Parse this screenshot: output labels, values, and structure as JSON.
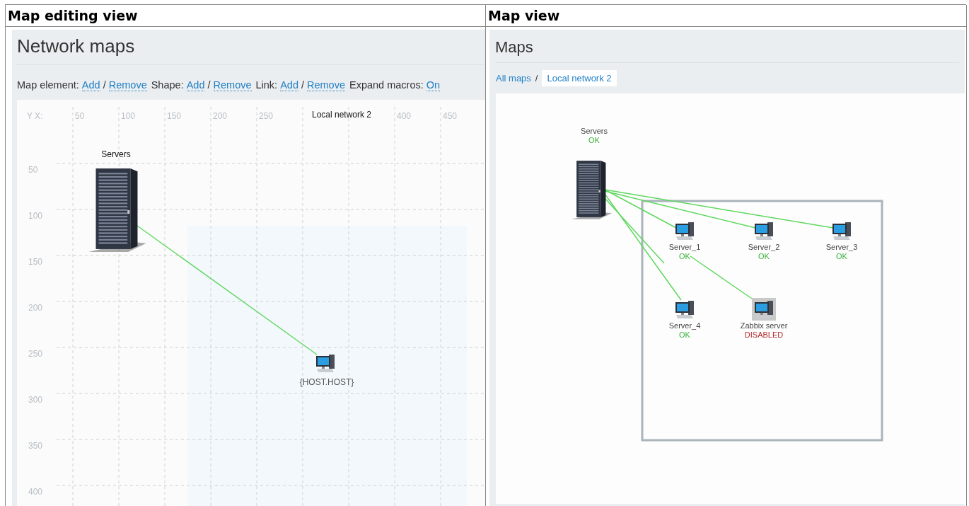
{
  "columns": [
    {
      "heading": "Map editing view"
    },
    {
      "heading": "Map view"
    }
  ],
  "map_editing": {
    "title": "Network maps",
    "toolbar": [
      {
        "label": "Map element:",
        "links": [
          "Add",
          "Remove"
        ],
        "separator": "/"
      },
      {
        "label": "Shape:",
        "links": [
          "Add",
          "Remove"
        ],
        "separator": "/"
      },
      {
        "label": "Link:",
        "links": [
          "Add",
          "Remove"
        ],
        "separator": "/"
      },
      {
        "label": "Expand macros:",
        "links": [
          "On"
        ]
      }
    ],
    "map": {
      "title": "Local network 2",
      "axis_label": "Y X:",
      "xticks": [
        "50",
        "100",
        "150",
        "200",
        "250",
        "400",
        "450"
      ],
      "yticks": [
        "50",
        "100",
        "150",
        "200",
        "250",
        "300",
        "350",
        "400"
      ],
      "elements": [
        {
          "label": "Servers"
        },
        {
          "label": "{HOST.HOST}"
        }
      ]
    }
  },
  "map_view": {
    "title": "Maps",
    "breadcrumbs": [
      {
        "label": "All maps",
        "selected": false
      },
      {
        "label": "Local network 2",
        "selected": true
      }
    ],
    "breadcrumb_separator": "/",
    "map": {
      "elements": [
        {
          "label": "Servers",
          "status": "OK",
          "kind": "ok"
        },
        {
          "label": "Server_1",
          "status": "OK",
          "kind": "ok"
        },
        {
          "label": "Server_2",
          "status": "OK",
          "kind": "ok"
        },
        {
          "label": "Server_3",
          "status": "OK",
          "kind": "ok"
        },
        {
          "label": "Server_4",
          "status": "OK",
          "kind": "ok"
        },
        {
          "label": "Zabbix server",
          "status": "DISABLED",
          "kind": "disabled"
        }
      ]
    }
  }
}
